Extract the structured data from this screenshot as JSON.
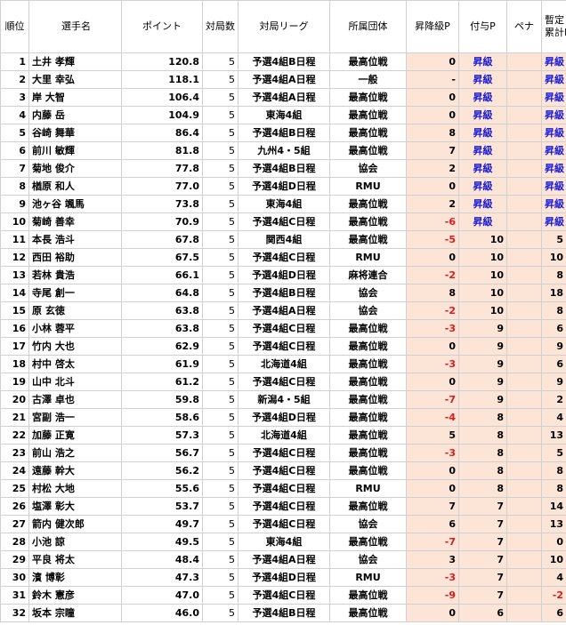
{
  "header": {
    "rank": "順位",
    "name": "選手名",
    "points": "ポイント",
    "games": "対局数",
    "league": "対局リーグ",
    "org": "所属団体",
    "prom": "昇降級P",
    "grant": "付与P",
    "pena": "ペナ",
    "total_line1": "暫定",
    "total_line2": "累計P"
  },
  "rows": [
    {
      "rank": "1",
      "name": "土井 孝輝",
      "points": "120.8",
      "games": "5",
      "league": "予選4組B日程",
      "org": "最高位戦",
      "prom": "0",
      "grant": "昇級",
      "total": "昇級"
    },
    {
      "rank": "2",
      "name": "大里 幸弘",
      "points": "118.1",
      "games": "5",
      "league": "予選4組A日程",
      "org": "一般",
      "prom": "-",
      "grant": "昇級",
      "total": "昇級"
    },
    {
      "rank": "3",
      "name": "岸 大智",
      "points": "106.4",
      "games": "5",
      "league": "予選4組A日程",
      "org": "最高位戦",
      "prom": "0",
      "grant": "昇級",
      "total": "昇級"
    },
    {
      "rank": "4",
      "name": "内藤 岳",
      "points": "104.9",
      "games": "5",
      "league": "東海4組",
      "org": "最高位戦",
      "prom": "0",
      "grant": "昇級",
      "total": "昇級"
    },
    {
      "rank": "5",
      "name": "谷崎 舞華",
      "points": "86.4",
      "games": "5",
      "league": "予選4組B日程",
      "org": "最高位戦",
      "prom": "8",
      "grant": "昇級",
      "total": "昇級"
    },
    {
      "rank": "6",
      "name": "前川 敏輝",
      "points": "81.8",
      "games": "5",
      "league": "九州4・5組",
      "org": "最高位戦",
      "prom": "7",
      "grant": "昇級",
      "total": "昇級"
    },
    {
      "rank": "7",
      "name": "菊地 俊介",
      "points": "77.8",
      "games": "5",
      "league": "予選4組B日程",
      "org": "協会",
      "prom": "2",
      "grant": "昇級",
      "total": "昇級"
    },
    {
      "rank": "8",
      "name": "楢原 和人",
      "points": "77.0",
      "games": "5",
      "league": "予選4組D日程",
      "org": "RMU",
      "prom": "0",
      "grant": "昇級",
      "total": "昇級"
    },
    {
      "rank": "9",
      "name": "池ヶ谷 颯馬",
      "points": "73.8",
      "games": "5",
      "league": "東海4組",
      "org": "最高位戦",
      "prom": "2",
      "grant": "昇級",
      "total": "昇級"
    },
    {
      "rank": "10",
      "name": "菊崎 善幸",
      "points": "70.9",
      "games": "5",
      "league": "予選4組C日程",
      "org": "最高位戦",
      "prom": "-6",
      "grant": "昇級",
      "total": "昇級"
    },
    {
      "rank": "11",
      "name": "本長 浩斗",
      "points": "67.8",
      "games": "5",
      "league": "関西4組",
      "org": "最高位戦",
      "prom": "-5",
      "grant": "10",
      "total": "5"
    },
    {
      "rank": "12",
      "name": "西田 裕助",
      "points": "67.5",
      "games": "5",
      "league": "予選4組C日程",
      "org": "RMU",
      "prom": "0",
      "grant": "10",
      "total": "10"
    },
    {
      "rank": "13",
      "name": "若林 貴浩",
      "points": "66.1",
      "games": "5",
      "league": "予選4組D日程",
      "org": "麻将連合",
      "prom": "-2",
      "grant": "10",
      "total": "8"
    },
    {
      "rank": "14",
      "name": "寺尾 創一",
      "points": "64.8",
      "games": "5",
      "league": "予選4組B日程",
      "org": "協会",
      "prom": "8",
      "grant": "10",
      "total": "18"
    },
    {
      "rank": "15",
      "name": "原 玄徳",
      "points": "63.8",
      "games": "5",
      "league": "予選4組A日程",
      "org": "協会",
      "prom": "-2",
      "grant": "10",
      "total": "8"
    },
    {
      "rank": "16",
      "name": "小林 蓉平",
      "points": "63.8",
      "games": "5",
      "league": "予選4組C日程",
      "org": "最高位戦",
      "prom": "-3",
      "grant": "9",
      "total": "6"
    },
    {
      "rank": "17",
      "name": "竹内 大也",
      "points": "62.9",
      "games": "5",
      "league": "予選4組C日程",
      "org": "最高位戦",
      "prom": "0",
      "grant": "9",
      "total": "9"
    },
    {
      "rank": "18",
      "name": "村中 啓太",
      "points": "61.9",
      "games": "5",
      "league": "北海道4組",
      "org": "最高位戦",
      "prom": "-3",
      "grant": "9",
      "total": "6"
    },
    {
      "rank": "19",
      "name": "山中 北斗",
      "points": "61.2",
      "games": "5",
      "league": "予選4組C日程",
      "org": "最高位戦",
      "prom": "0",
      "grant": "9",
      "total": "9"
    },
    {
      "rank": "20",
      "name": "古澤 卓也",
      "points": "59.8",
      "games": "5",
      "league": "新潟4・5組",
      "org": "最高位戦",
      "prom": "-7",
      "grant": "9",
      "total": "2"
    },
    {
      "rank": "21",
      "name": "宮副 浩一",
      "points": "58.6",
      "games": "5",
      "league": "予選4組D日程",
      "org": "最高位戦",
      "prom": "-4",
      "grant": "8",
      "total": "4"
    },
    {
      "rank": "22",
      "name": "加藤 正寛",
      "points": "57.3",
      "games": "5",
      "league": "北海道4組",
      "org": "最高位戦",
      "prom": "5",
      "grant": "8",
      "total": "13"
    },
    {
      "rank": "23",
      "name": "前山 浩之",
      "points": "56.7",
      "games": "5",
      "league": "予選4組C日程",
      "org": "最高位戦",
      "prom": "-3",
      "grant": "8",
      "total": "5"
    },
    {
      "rank": "24",
      "name": "遠藤 幹大",
      "points": "56.2",
      "games": "5",
      "league": "予選4組C日程",
      "org": "最高位戦",
      "prom": "0",
      "grant": "8",
      "total": "8"
    },
    {
      "rank": "25",
      "name": "村松 大地",
      "points": "55.6",
      "games": "5",
      "league": "予選4組C日程",
      "org": "RMU",
      "prom": "0",
      "grant": "8",
      "total": "8"
    },
    {
      "rank": "26",
      "name": "塩澤 彰大",
      "points": "53.7",
      "games": "5",
      "league": "予選4組C日程",
      "org": "最高位戦",
      "prom": "7",
      "grant": "7",
      "total": "14"
    },
    {
      "rank": "27",
      "name": "箭内 健次郎",
      "points": "49.7",
      "games": "5",
      "league": "予選4組C日程",
      "org": "協会",
      "prom": "6",
      "grant": "7",
      "total": "13"
    },
    {
      "rank": "28",
      "name": "小池 諒",
      "points": "49.5",
      "games": "5",
      "league": "東海4組",
      "org": "最高位戦",
      "prom": "-7",
      "grant": "7",
      "total": "0"
    },
    {
      "rank": "29",
      "name": "平良 将太",
      "points": "48.4",
      "games": "5",
      "league": "予選4組A日程",
      "org": "協会",
      "prom": "3",
      "grant": "7",
      "total": "10"
    },
    {
      "rank": "30",
      "name": "濱 博彰",
      "points": "47.3",
      "games": "5",
      "league": "予選4組D日程",
      "org": "RMU",
      "prom": "-3",
      "grant": "7",
      "total": "4"
    },
    {
      "rank": "31",
      "name": "鈴木 憲彦",
      "points": "47.0",
      "games": "5",
      "league": "予選4組C日程",
      "org": "最高位戦",
      "prom": "-9",
      "grant": "7",
      "total": "-2"
    },
    {
      "rank": "32",
      "name": "坂本 宗瞳",
      "points": "46.0",
      "games": "5",
      "league": "予選4組B日程",
      "org": "最高位戦",
      "prom": "0",
      "grant": "6",
      "total": "6"
    }
  ]
}
